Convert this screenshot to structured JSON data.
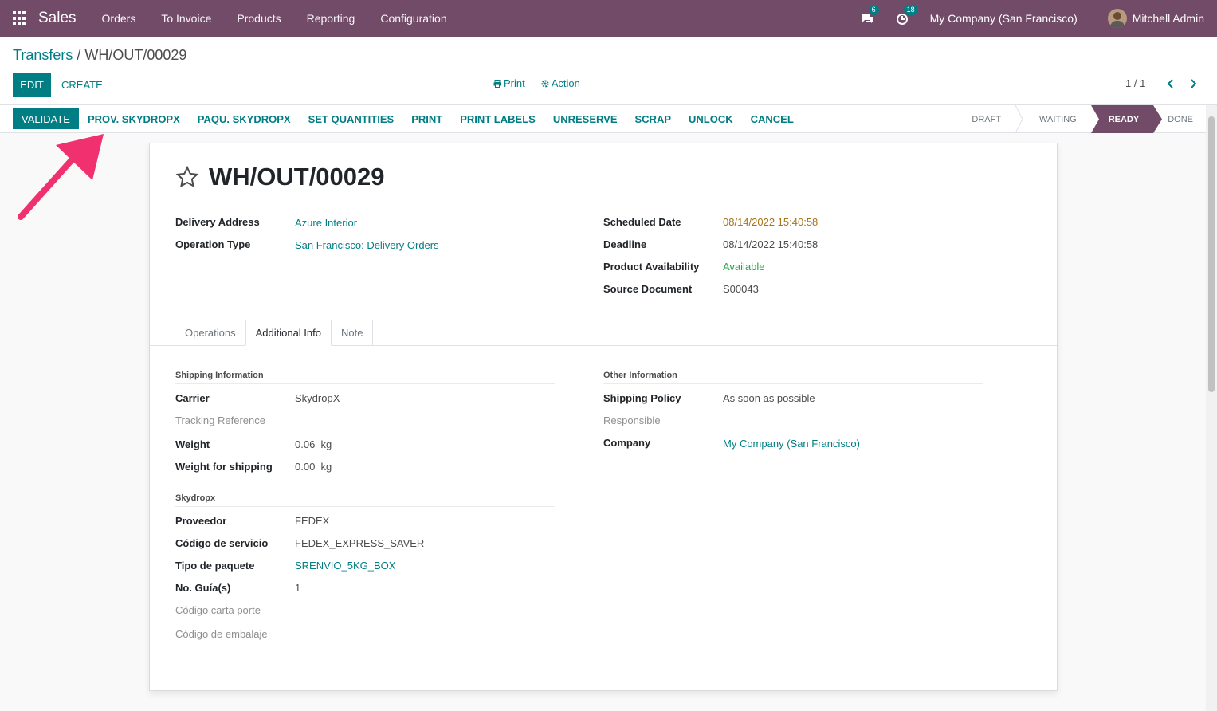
{
  "navbar": {
    "app_name": "Sales",
    "menu": [
      "Orders",
      "To Invoice",
      "Products",
      "Reporting",
      "Configuration"
    ],
    "messages_badge": "6",
    "activities_badge": "18",
    "company": "My Company (San Francisco)",
    "user": "Mitchell Admin"
  },
  "control": {
    "breadcrumb_parent": "Transfers",
    "breadcrumb_sep": " / ",
    "breadcrumb_current": "WH/OUT/00029",
    "edit_label": "EDIT",
    "create_label": "CREATE",
    "print_label": "Print",
    "action_label": "Action",
    "pager": "1 / 1"
  },
  "statusbar": {
    "buttons": [
      "VALIDATE",
      "PROV. SKYDROPX",
      "PAQU. SKYDROPX",
      "SET QUANTITIES",
      "PRINT",
      "PRINT LABELS",
      "UNRESERVE",
      "SCRAP",
      "UNLOCK",
      "CANCEL"
    ],
    "stages": [
      "DRAFT",
      "WAITING",
      "READY",
      "DONE"
    ],
    "active_stage": "READY"
  },
  "record": {
    "name": "WH/OUT/00029",
    "left_fields": [
      {
        "label": "Delivery Address",
        "value": "Azure Interior"
      },
      {
        "label": "Operation Type",
        "value": "San Francisco: Delivery Orders"
      }
    ],
    "right_fields": [
      {
        "label": "Scheduled Date",
        "value": "08/14/2022 15:40:58"
      },
      {
        "label": "Deadline",
        "value": "08/14/2022 15:40:58"
      },
      {
        "label": "Product Availability",
        "value": "Available"
      },
      {
        "label": "Source Document",
        "value": "S00043"
      }
    ]
  },
  "tabs": [
    "Operations",
    "Additional Info",
    "Note"
  ],
  "additional_info": {
    "shipping_title": "Shipping Information",
    "shipping": [
      {
        "label": "Carrier",
        "value": "SkydropX"
      },
      {
        "label": "Tracking Reference",
        "value": ""
      },
      {
        "label": "Weight",
        "value": "0.06",
        "unit": "kg"
      },
      {
        "label": "Weight for shipping",
        "value": "0.00",
        "unit": "kg"
      }
    ],
    "skydropx_title": "Skydropx",
    "skydropx": [
      {
        "label": "Proveedor",
        "value": "FEDEX"
      },
      {
        "label": "Código de servicio",
        "value": "FEDEX_EXPRESS_SAVER"
      },
      {
        "label": "Tipo de paquete",
        "value": "SRENVIO_5KG_BOX"
      },
      {
        "label": "No. Guía(s)",
        "value": "1"
      },
      {
        "label": "Código carta porte",
        "value": ""
      },
      {
        "label": "Código de embalaje",
        "value": ""
      }
    ],
    "other_title": "Other Information",
    "other": [
      {
        "label": "Shipping Policy",
        "value": "As soon as possible"
      },
      {
        "label": "Responsible",
        "value": ""
      },
      {
        "label": "Company",
        "value": "My Company (San Francisco)"
      }
    ]
  },
  "colors": {
    "brand": "#714b67",
    "accent": "#017e84",
    "annotation_arrow": "#f0306f"
  }
}
